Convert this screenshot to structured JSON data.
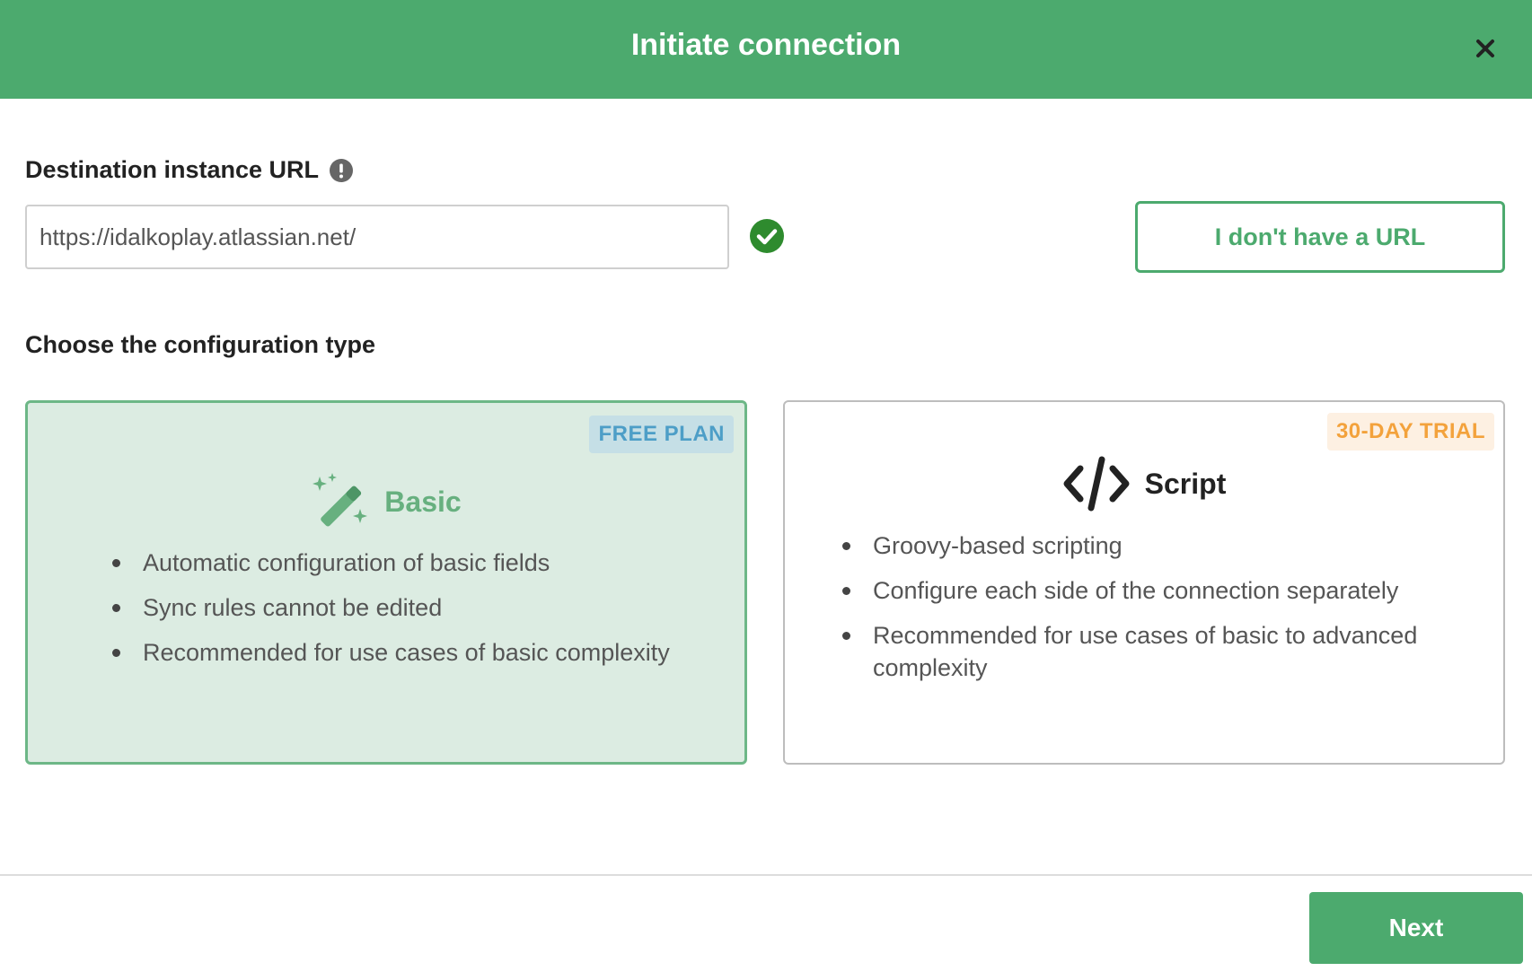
{
  "dialog": {
    "title": "Initiate connection"
  },
  "url_section": {
    "label": "Destination instance URL",
    "value": "https://idalkoplay.atlassian.net/",
    "no_url_label": "I don't have a URL"
  },
  "config_section": {
    "label": "Choose the configuration type",
    "basic": {
      "badge": "FREE PLAN",
      "title": "Basic",
      "icon": "magic-wand-icon",
      "features": [
        "Automatic configuration of basic fields",
        "Sync rules cannot be edited",
        "Recommended for use cases of basic complexity"
      ]
    },
    "script": {
      "badge": "30-DAY TRIAL",
      "title": "Script",
      "icon": "code-icon",
      "features": [
        "Groovy-based scripting",
        "Configure each side of the connection separately",
        "Recommended for use cases of basic to advanced complexity"
      ]
    }
  },
  "footer": {
    "next_label": "Next"
  },
  "colors": {
    "brand_green": "#4caa6e",
    "selected_card_bg": "#dcece2",
    "free_badge_text": "#4d9ec7",
    "trial_badge_text": "#f3a23c",
    "valid_check": "#2e8b2e"
  }
}
